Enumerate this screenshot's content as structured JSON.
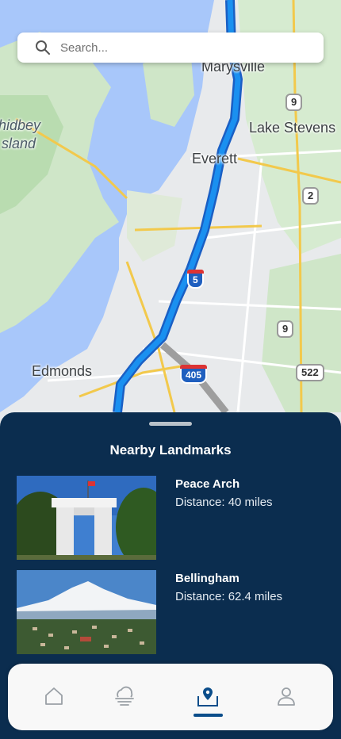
{
  "search": {
    "placeholder": "Search..."
  },
  "map": {
    "labels": {
      "marysville": "Marysville",
      "lake_stevens": "Lake Stevens",
      "everett": "Everett",
      "whidbey_1": "hidbey",
      "whidbey_2": "sland",
      "edmonds": "Edmonds"
    },
    "shields": {
      "sr9_top": "9",
      "us2": "2",
      "i5": "5",
      "sr9_bottom": "9",
      "i405": "405",
      "sr522": "522"
    },
    "colors": {
      "route": "#1a73e8",
      "water": "#a8c7fa",
      "land": "#e8eaec",
      "park": "#cce8c5"
    }
  },
  "sheet": {
    "title": "Nearby Landmarks",
    "landmarks": [
      {
        "name": "Peace Arch",
        "distance": "Distance: 40 miles"
      },
      {
        "name": "Bellingham",
        "distance": "Distance: 62.4 miles"
      }
    ]
  },
  "nav": {
    "active": "map",
    "items": [
      "home-icon",
      "weather-icon",
      "map-pin-icon",
      "profile-icon"
    ],
    "colors": {
      "active": "#0b4d8a",
      "inactive": "#9aa0a6"
    }
  }
}
